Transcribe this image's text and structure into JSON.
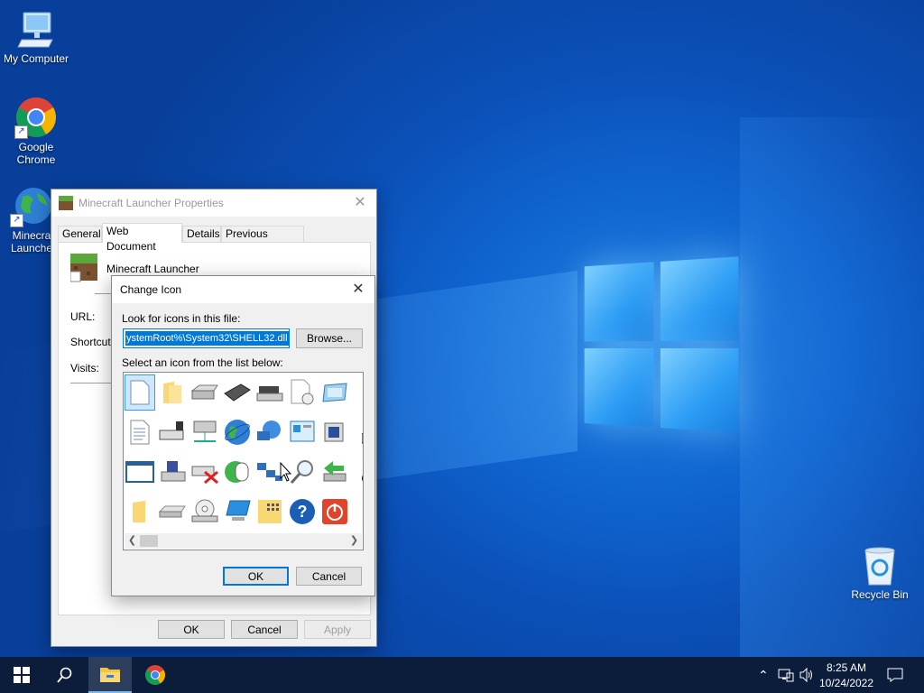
{
  "desktop": {
    "icons": [
      {
        "label": "My Computer",
        "icon": "computer-icon"
      },
      {
        "label": "Google Chrome",
        "label_line1": "Google",
        "label_line2": "Chrome",
        "icon": "chrome-icon"
      },
      {
        "label_line1": "Minecra",
        "label_line2": "Launche",
        "icon": "globe-icon"
      },
      {
        "label": "Recycle Bin",
        "icon": "recycle-bin-icon"
      }
    ]
  },
  "properties_dialog": {
    "title": "Minecraft Launcher Properties",
    "tabs": [
      "General",
      "Web Document",
      "Details",
      "Previous Versions"
    ],
    "active_tab": "Web Document",
    "app_name": "Minecraft Launcher",
    "fields": {
      "url": "URL:",
      "shortcut": "Shortcut k",
      "visits": "Visits:"
    },
    "buttons": {
      "ok": "OK",
      "cancel": "Cancel",
      "apply": "Apply"
    }
  },
  "change_icon_dialog": {
    "title": "Change Icon",
    "look_label": "Look for icons in this file:",
    "file_value": "ystemRoot%\\System32\\SHELL32.dll",
    "browse": "Browse...",
    "select_label": "Select an icon from the list below:",
    "buttons": {
      "ok": "OK",
      "cancel": "Cancel"
    }
  },
  "taskbar": {
    "time": "8:25 AM",
    "date": "10/24/2022"
  },
  "colors": {
    "accent": "#0078d7",
    "taskbar": "#0b1d3a"
  }
}
